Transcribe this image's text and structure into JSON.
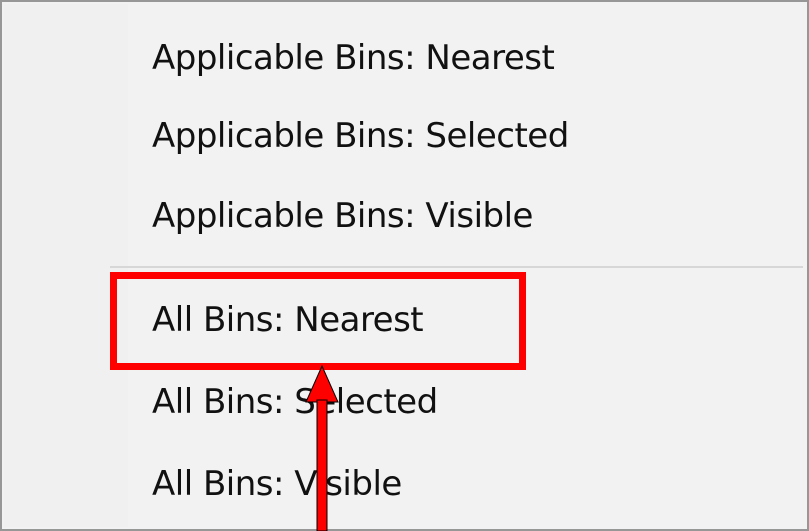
{
  "menu": {
    "items": [
      {
        "label": "Applicable Bins: Nearest"
      },
      {
        "label": "Applicable Bins: Selected"
      },
      {
        "label": "Applicable Bins: Visible"
      },
      {
        "label": "All Bins: Nearest"
      },
      {
        "label": "All Bins: Selected"
      },
      {
        "label": "All Bins: Visible"
      }
    ]
  },
  "annotation": {
    "color": "#ff0000",
    "target": "All Bins: Nearest",
    "icon": "arrow-up-icon"
  }
}
